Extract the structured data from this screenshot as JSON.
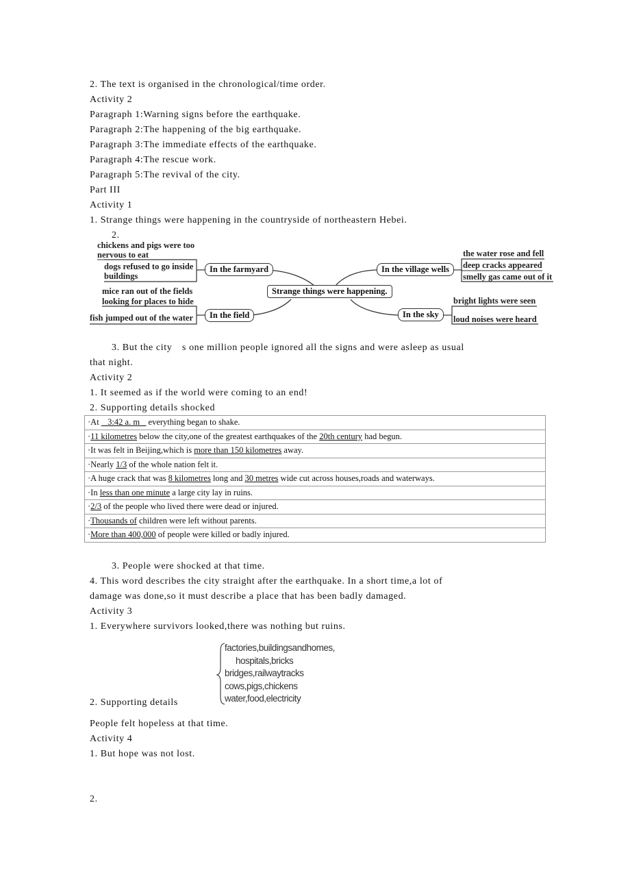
{
  "lines": {
    "l1": "2. The text is organised in the chronological/time order.",
    "l2": "Activity 2",
    "l3": "Paragraph 1:Warning signs before the earthquake.",
    "l4": "Paragraph 2:The happening of the big earthquake.",
    "l5": "Paragraph 3:The immediate effects of the earthquake.",
    "l6": "Paragraph 4:The rescue work.",
    "l7": "Paragraph 5:The revival of the city.",
    "l8": "Part III",
    "l9": "Activity 1",
    "l10": "1. Strange things were happening in the countryside of northeastern Hebei.",
    "l11": "2.",
    "l12": "3. But the city　s one million people ignored all the signs and were asleep as usual",
    "l13": "that night.",
    "l14": "Activity 2",
    "l15": "1. It seemed as if the world were coming to an end!",
    "l16": "2. Supporting details shocked",
    "l17": "3. People were shocked at that time.",
    "l18": "4. This word describes the city straight after the earthquake. In a short time,a lot of",
    "l19": "damage was done,so it must describe a place that has been badly damaged.",
    "l20": "Activity 3",
    "l21": "1. Everywhere survivors looked,there was nothing but ruins.",
    "l22": "2. Supporting details",
    "l23": "People felt hopeless at that time.",
    "l24": "Activity 4",
    "l25": "1. But hope was not lost.",
    "l26": "2."
  },
  "mindmap": {
    "center": "Strange things were happening.",
    "branches": {
      "farmyard": {
        "label": "In the farmyard",
        "items": [
          "chickens and pigs were too",
          "nervous to eat",
          "dogs refused to go inside",
          "buildings"
        ]
      },
      "field": {
        "label": "In the field",
        "items": [
          "mice ran out of  the fields",
          "looking for places to hide",
          "fish jumped out of  the water"
        ]
      },
      "wells": {
        "label": "In the village wells",
        "items": [
          "the water rose and fell",
          "deep cracks appeared",
          "smelly gas came out of it"
        ]
      },
      "sky": {
        "label": "In the sky",
        "items": [
          "bright lights were seen",
          "loud noises were heard"
        ]
      }
    }
  },
  "table": {
    "rows": [
      {
        "pre": "·At ",
        "u1": "   3:42 a. m   ",
        "mid": " everything began to shake.",
        "u2": "",
        "post": ""
      },
      {
        "pre": "·",
        "u1": "11 kilometres",
        "mid": " below the city,one of the greatest earthquakes of the ",
        "u2": "20th century",
        "post": " had begun."
      },
      {
        "pre": "·It was felt in Beijing,which is ",
        "u1": "more than 150 kilometres",
        "mid": " away.",
        "u2": "",
        "post": ""
      },
      {
        "pre": "·Nearly ",
        "u1": "1/3",
        "mid": " of the whole nation felt it.",
        "u2": "",
        "post": ""
      },
      {
        "pre": "·A huge crack that was ",
        "u1": "8 kilometres",
        "mid": " long and ",
        "u2": "30 metres",
        "post": " wide cut across houses,roads and waterways."
      },
      {
        "pre": "·In ",
        "u1": "less than one minute",
        "mid": " a large city lay in ruins.",
        "u2": "",
        "post": ""
      },
      {
        "pre": "·",
        "u1": "2/3",
        "mid": " of the people who lived there were dead or injured.",
        "u2": "",
        "post": ""
      },
      {
        "pre": "·",
        "u1": "Thousands of",
        "mid": " children were left without parents.",
        "u2": "",
        "post": ""
      },
      {
        "pre": "·",
        "u1": "More than 400,000",
        "mid": " of people were killed or badly injured.",
        "u2": "",
        "post": ""
      }
    ]
  },
  "ruins_list": {
    "items": [
      "factories,buildingsandhomes,",
      "hospitals,bricks",
      "bridges,railwaytracks",
      "cows,pigs,chickens",
      "water,food,electricity"
    ]
  }
}
